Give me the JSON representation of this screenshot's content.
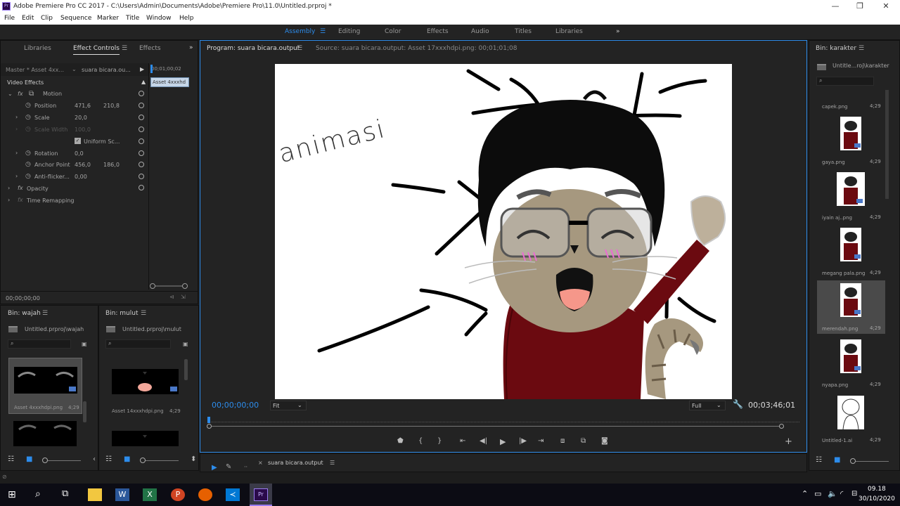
{
  "window": {
    "title": "Adobe Premiere Pro CC 2017 - C:\\Users\\Admin\\Documents\\Adobe\\Premiere Pro\\11.0\\Untitled.prproj *",
    "minimize": "—",
    "restore": "❐",
    "close": "✕"
  },
  "menu": [
    "File",
    "Edit",
    "Clip",
    "Sequence",
    "Marker",
    "Title",
    "Window",
    "Help"
  ],
  "workspaces": {
    "items": [
      "Assembly",
      "Editing",
      "Color",
      "Effects",
      "Audio",
      "Titles",
      "Libraries"
    ],
    "active": "Assembly",
    "more": "»"
  },
  "left_panel": {
    "tabs": [
      "Libraries",
      "Effect Controls",
      "Effects"
    ],
    "master": "Master * Asset 4xx...",
    "clip": "suara bicara.ou...",
    "timecode_top": "00;01;00;02",
    "clip_tag": "Asset 4xxxhd",
    "section": "Video Effects",
    "motion": "Motion",
    "props": [
      {
        "name": "Position",
        "v1": "471,6",
        "v2": "210,8"
      },
      {
        "name": "Scale",
        "v1": "20,0",
        "v2": ""
      },
      {
        "name": "Scale Width",
        "v1": "100,0",
        "v2": ""
      },
      {
        "name": "Uniform Sc...",
        "v1": "",
        "v2": ""
      },
      {
        "name": "Rotation",
        "v1": "0,0",
        "v2": ""
      },
      {
        "name": "Anchor Point",
        "v1": "456,0",
        "v2": "186,0"
      },
      {
        "name": "Anti-flicker...",
        "v1": "0,00",
        "v2": ""
      }
    ],
    "opacity": "Opacity",
    "time_remap": "Time Remapping",
    "timecode_bottom": "00;00;00;00"
  },
  "bin_wajah": {
    "title": "Bin: wajah",
    "path": "Untitled.prproj\\wajah",
    "item": "Asset 4xxxhdpi.png",
    "dur": "4;29"
  },
  "bin_mulut": {
    "title": "Bin: mulut",
    "path": "Untitled.prproj\\mulut",
    "item": "Asset 14xxxhdpi.png",
    "dur": "4;29"
  },
  "program": {
    "tab": "Program: suara bicara.output",
    "source": "Source: suara bicara.output: Asset 17xxxhdpi.png: 00;01;01;08",
    "timecode": "00;00;00;00",
    "fit": "Fit",
    "quality": "Full",
    "duration": "00;03;46;01",
    "canvas_text": "animasi"
  },
  "timeline": {
    "tab": "suara bicara.output"
  },
  "bin_karakter": {
    "title": "Bin: karakter",
    "path": "Untitle...roj\\karakter",
    "items": [
      {
        "name": "capek.png",
        "dur": "4;29"
      },
      {
        "name": "gaya.png",
        "dur": "4;29"
      },
      {
        "name": "iyain aj..png",
        "dur": "4;29"
      },
      {
        "name": "megang pala.png",
        "dur": "4;29"
      },
      {
        "name": "merendah.png",
        "dur": "4;29"
      },
      {
        "name": "nyapa.png",
        "dur": "4;29"
      },
      {
        "name": "Untitled-1.ai",
        "dur": "4;29"
      }
    ]
  },
  "clock": {
    "time": "09.18",
    "date": "30/10/2020"
  }
}
